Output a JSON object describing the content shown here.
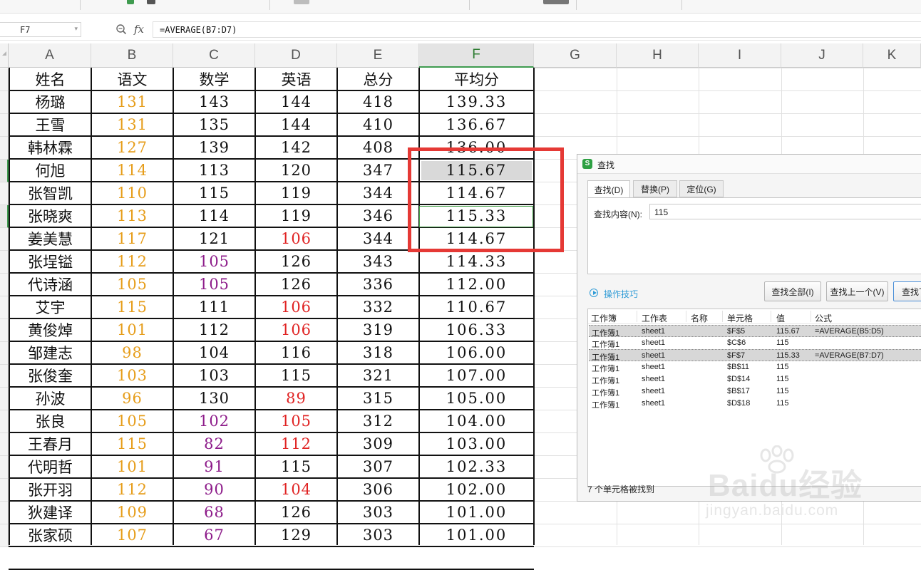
{
  "formula_bar": {
    "cell_ref": "F7",
    "fx_label": "fx",
    "formula": "=AVERAGE(B7:D7)"
  },
  "columns": [
    "A",
    "B",
    "C",
    "D",
    "E",
    "F",
    "G",
    "H",
    "I",
    "J",
    "K"
  ],
  "header_row": [
    "姓名",
    "语文",
    "数学",
    "英语",
    "总分",
    "平均分"
  ],
  "rows": [
    [
      "杨璐",
      "131",
      "143",
      "144",
      "418",
      "139.33"
    ],
    [
      "王雪",
      "131",
      "135",
      "144",
      "410",
      "136.67"
    ],
    [
      "韩林霖",
      "127",
      "139",
      "142",
      "408",
      "136.00"
    ],
    [
      "何旭",
      "114",
      "113",
      "120",
      "347",
      "115.67"
    ],
    [
      "张智凯",
      "110",
      "115",
      "119",
      "344",
      "114.67"
    ],
    [
      "张晓爽",
      "113",
      "114",
      "119",
      "346",
      "115.33"
    ],
    [
      "姜美慧",
      "117",
      "121",
      "106",
      "344",
      "114.67"
    ],
    [
      "张埕镒",
      "112",
      "105",
      "126",
      "343",
      "114.33"
    ],
    [
      "代诗涵",
      "105",
      "105",
      "126",
      "336",
      "112.00"
    ],
    [
      "艾宇",
      "115",
      "111",
      "106",
      "332",
      "110.67"
    ],
    [
      "黄俊焯",
      "101",
      "112",
      "106",
      "319",
      "106.33"
    ],
    [
      "邹建志",
      "98",
      "104",
      "116",
      "318",
      "106.00"
    ],
    [
      "张俊奎",
      "103",
      "103",
      "115",
      "321",
      "107.00"
    ],
    [
      "孙波",
      "96",
      "130",
      "89",
      "315",
      "105.00"
    ],
    [
      "张良",
      "105",
      "102",
      "105",
      "312",
      "104.00"
    ],
    [
      "王春月",
      "115",
      "82",
      "112",
      "309",
      "103.00"
    ],
    [
      "代明哲",
      "101",
      "91",
      "115",
      "307",
      "102.33"
    ],
    [
      "张开羽",
      "112",
      "90",
      "104",
      "306",
      "102.00"
    ],
    [
      "狄建译",
      "109",
      "68",
      "126",
      "303",
      "101.00"
    ],
    [
      "张家硕",
      "107",
      "67",
      "129",
      "303",
      "101.00"
    ]
  ],
  "cell_colors": {
    "orange": "#e69d1a",
    "purple": "#8d1c8a",
    "red": "#e02424"
  },
  "colored_cells": {
    "B": "orange",
    "C_purple_rows": [
      7,
      8,
      14,
      15,
      16,
      17,
      18,
      19
    ],
    "D_red_rows": [
      6,
      9,
      10,
      13,
      14,
      15,
      17
    ]
  },
  "find_dialog": {
    "title": "查找",
    "tabs": [
      "查找(D)",
      "替换(P)",
      "定位(G)"
    ],
    "find_label": "查找内容(N):",
    "find_value": "115",
    "tips_label": "操作技巧",
    "buttons": {
      "find_all": "查找全部(I)",
      "find_prev": "查找上一个(V)",
      "find_next": "查找下"
    },
    "result_headers": [
      "工作簿",
      "工作表",
      "名称",
      "单元格",
      "值",
      "公式"
    ],
    "results": [
      [
        "工作簿1",
        "sheet1",
        "",
        "$F$5",
        "115.67",
        "=AVERAGE(B5:D5)"
      ],
      [
        "工作簿1",
        "sheet1",
        "",
        "$C$6",
        "115",
        ""
      ],
      [
        "工作簿1",
        "sheet1",
        "",
        "$F$7",
        "115.33",
        "=AVERAGE(B7:D7)"
      ],
      [
        "工作簿1",
        "sheet1",
        "",
        "$B$11",
        "115",
        ""
      ],
      [
        "工作簿1",
        "sheet1",
        "",
        "$D$14",
        "115",
        ""
      ],
      [
        "工作簿1",
        "sheet1",
        "",
        "$B$17",
        "115",
        ""
      ],
      [
        "工作簿1",
        "sheet1",
        "",
        "$D$18",
        "115",
        ""
      ]
    ],
    "highlighted_results": [
      0,
      2
    ],
    "status": "7 个单元格被找到"
  },
  "watermark": {
    "brand": "Baidu经验",
    "url": "jingyan.baidu.com"
  },
  "accent_colors": {
    "selection_green": "#3f9b4f",
    "annotation_red": "#e53935",
    "link_blue": "#2e9bd6"
  }
}
